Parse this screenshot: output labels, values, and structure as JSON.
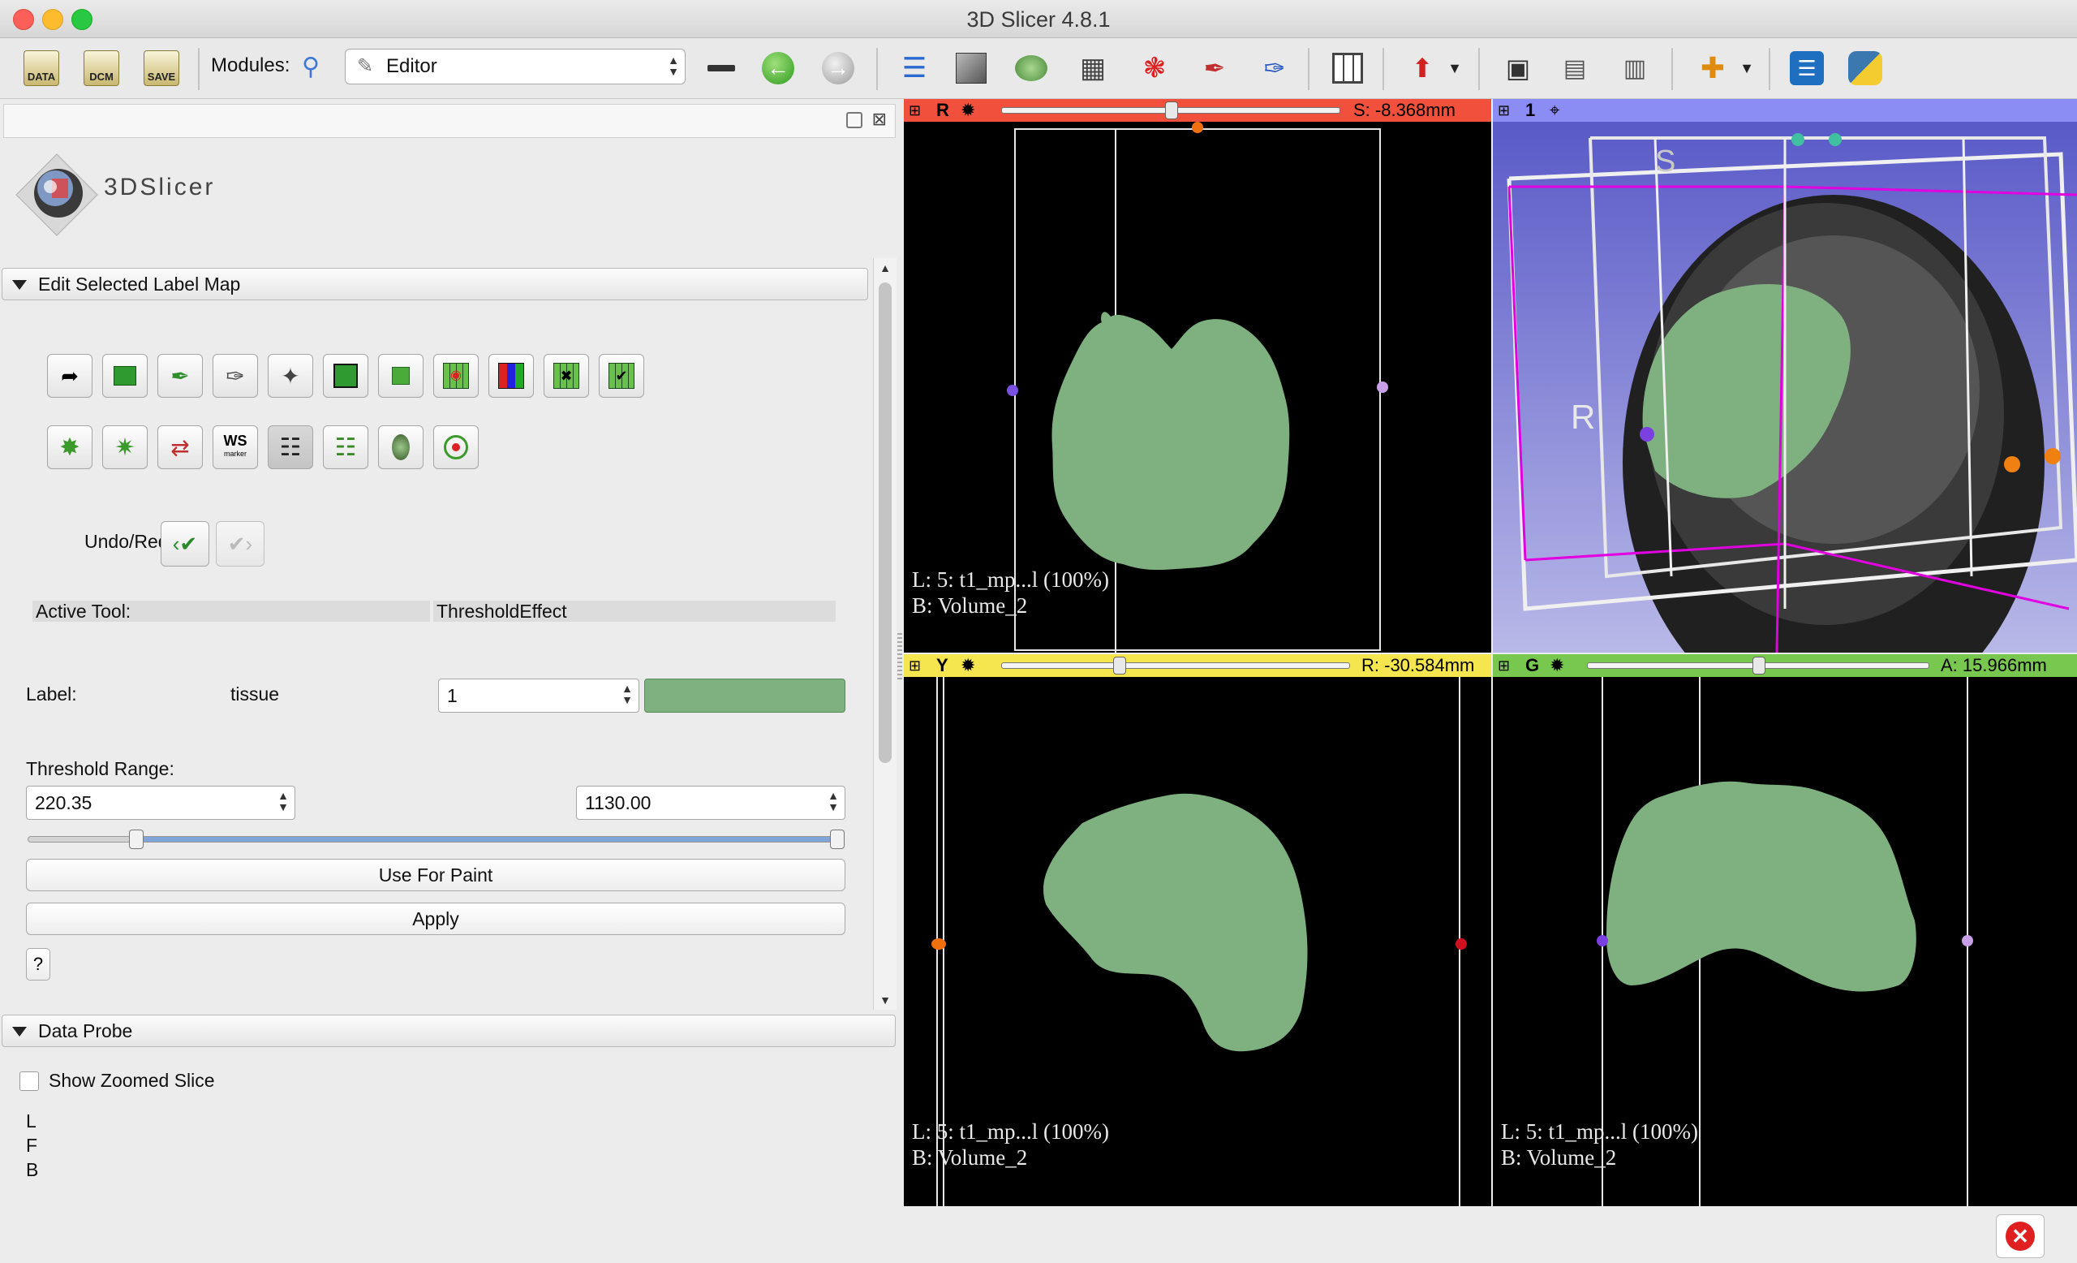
{
  "window": {
    "title": "3D Slicer 4.8.1"
  },
  "toolbar": {
    "data_label": "DATA",
    "dcm_label": "DCM",
    "save_label": "SAVE",
    "modules_label": "Modules:",
    "module_selected": "Editor"
  },
  "panel": {
    "logo_text": "3DSlicer",
    "section_edit": "Edit Selected Label Map",
    "ws_label": "WS",
    "ws_sub": "marker",
    "undo_redo_label": "Undo/Redo:",
    "active_tool_label": "Active Tool:",
    "active_tool_value": "ThresholdEffect",
    "label_label": "Label:",
    "label_name": "tissue",
    "label_value": "1",
    "label_color": "#7fb07f",
    "threshold_label": "Threshold Range:",
    "threshold_min": "220.35",
    "threshold_max": "1130.00",
    "threshold_range_fraction": [
      0.125,
      1.0
    ],
    "use_for_paint": "Use For Paint",
    "apply": "Apply",
    "help": "?",
    "section_probe": "Data Probe",
    "show_zoomed_slice": "Show Zoomed Slice",
    "probe_lines": [
      "L",
      "F",
      "B"
    ]
  },
  "viewers": {
    "red": {
      "label": "R",
      "offset": "S: -8.368mm",
      "bar_color": "#f0503c",
      "slider_fraction": 0.5,
      "annot_l": "L: 5: t1_mp...l (100%)",
      "annot_b": "B: Volume_2"
    },
    "threed": {
      "label": "1",
      "bar_color": "#8c8cf5",
      "orient_s": "S",
      "orient_r": "R"
    },
    "yellow": {
      "label": "Y",
      "offset": "R: -30.584mm",
      "bar_color": "#f5e650",
      "slider_fraction": 0.33,
      "annot_l": "L: 5: t1_mp...l (100%)",
      "annot_b": "B: Volume_2"
    },
    "green": {
      "label": "G",
      "offset": "A: 15.966mm",
      "bar_color": "#78c850",
      "slider_fraction": 0.5,
      "annot_l": "L: 5: t1_mp...l (100%)",
      "annot_b": "B: Volume_2"
    }
  },
  "colors": {
    "label_map": "#7fb07f",
    "accent": "#3d78d8"
  }
}
